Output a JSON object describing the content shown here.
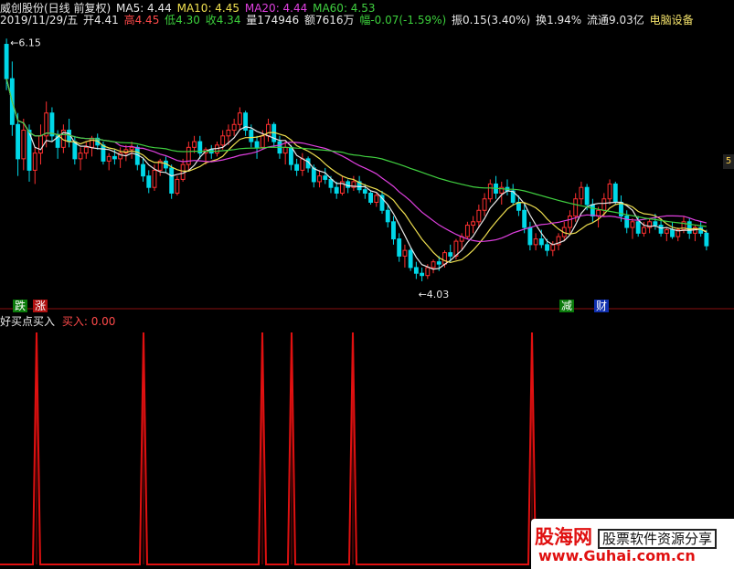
{
  "header": {
    "stock_name_date": "威创股份(日线 前复权) ",
    "ma5": "MA5: 4.44",
    "ma10": "MA10: 4.45",
    "ma20": "MA20: 4.44",
    "ma60": "MA60: 4.53",
    "date": "2019/11/29/五",
    "open": "开4.41",
    "high": "高4.45",
    "low": "低4.30",
    "close": "收4.34",
    "volume": "量174946",
    "amount": "额7616万",
    "change": "幅-0.07(-1.59%)",
    "amplitude": "振0.15(3.40%)",
    "turnover": "换1.94%",
    "float_cap": "流通9.03亿",
    "sector": "电脑设备"
  },
  "price_panel": {
    "max_label": "6.15",
    "min_label": "4.03",
    "right_tag": "5",
    "badges": [
      "跌",
      "涨",
      "减",
      "财"
    ]
  },
  "indicator_panel": {
    "name": "好买点买入",
    "value_label": "买入: 0.00"
  },
  "watermark": {
    "logo": "股海网",
    "slogan": "股票软件资源分享",
    "url": "www.Guhai.com.cn"
  },
  "colors": {
    "up": "#ff3030",
    "down": "#00d8e8",
    "ma5": "#e8e8e8",
    "ma10": "#f0e050",
    "ma20": "#e040e0",
    "ma60": "#40d040",
    "signal": "#e01010"
  },
  "chart_data": [
    {
      "type": "candlestick",
      "title": "威创股份(日线 前复权)",
      "ylim": [
        3.95,
        6.2
      ],
      "candles": [
        [
          6.1,
          6.15,
          5.7,
          5.8
        ],
        [
          5.8,
          5.95,
          5.3,
          5.4
        ],
        [
          5.4,
          5.5,
          4.95,
          5.1
        ],
        [
          5.1,
          5.45,
          5.0,
          5.35
        ],
        [
          5.35,
          5.4,
          4.9,
          5.0
        ],
        [
          5.0,
          5.2,
          4.88,
          5.15
        ],
        [
          5.15,
          5.4,
          5.05,
          5.3
        ],
        [
          5.3,
          5.6,
          5.2,
          5.5
        ],
        [
          5.5,
          5.55,
          5.25,
          5.3
        ],
        [
          5.3,
          5.35,
          5.1,
          5.2
        ],
        [
          5.2,
          5.4,
          5.15,
          5.35
        ],
        [
          5.35,
          5.45,
          5.2,
          5.25
        ],
        [
          5.25,
          5.3,
          5.05,
          5.1
        ],
        [
          5.1,
          5.2,
          5.0,
          5.15
        ],
        [
          5.15,
          5.25,
          5.1,
          5.2
        ],
        [
          5.2,
          5.3,
          5.12,
          5.28
        ],
        [
          5.28,
          5.32,
          5.18,
          5.22
        ],
        [
          5.22,
          5.25,
          5.05,
          5.08
        ],
        [
          5.08,
          5.15,
          5.0,
          5.12
        ],
        [
          5.12,
          5.18,
          5.05,
          5.1
        ],
        [
          5.1,
          5.2,
          5.02,
          5.15
        ],
        [
          5.15,
          5.22,
          5.08,
          5.18
        ],
        [
          5.18,
          5.25,
          5.1,
          5.2
        ],
        [
          5.2,
          5.22,
          5.0,
          5.05
        ],
        [
          5.05,
          5.1,
          4.9,
          4.95
        ],
        [
          4.95,
          5.0,
          4.8,
          4.85
        ],
        [
          4.85,
          5.05,
          4.82,
          5.0
        ],
        [
          5.0,
          5.1,
          4.95,
          5.08
        ],
        [
          5.08,
          5.12,
          4.98,
          5.02
        ],
        [
          5.02,
          5.05,
          4.75,
          4.8
        ],
        [
          4.8,
          4.95,
          4.78,
          4.92
        ],
        [
          4.92,
          5.1,
          4.9,
          5.05
        ],
        [
          5.05,
          5.25,
          5.0,
          5.2
        ],
        [
          5.2,
          5.3,
          5.15,
          5.25
        ],
        [
          5.25,
          5.3,
          5.1,
          5.15
        ],
        [
          5.15,
          5.2,
          5.05,
          5.18
        ],
        [
          5.18,
          5.22,
          5.1,
          5.15
        ],
        [
          5.15,
          5.25,
          5.12,
          5.22
        ],
        [
          5.22,
          5.35,
          5.18,
          5.3
        ],
        [
          5.3,
          5.4,
          5.22,
          5.35
        ],
        [
          5.35,
          5.45,
          5.3,
          5.4
        ],
        [
          5.4,
          5.55,
          5.35,
          5.5
        ],
        [
          5.5,
          5.52,
          5.3,
          5.35
        ],
        [
          5.35,
          5.4,
          5.2,
          5.25
        ],
        [
          5.25,
          5.3,
          5.1,
          5.2
        ],
        [
          5.2,
          5.35,
          5.18,
          5.3
        ],
        [
          5.3,
          5.45,
          5.25,
          5.4
        ],
        [
          5.4,
          5.42,
          5.2,
          5.25
        ],
        [
          5.25,
          5.3,
          5.1,
          5.15
        ],
        [
          5.15,
          5.25,
          5.05,
          5.2
        ],
        [
          5.2,
          5.22,
          5.0,
          5.05
        ],
        [
          5.05,
          5.1,
          4.95,
          5.0
        ],
        [
          5.0,
          5.15,
          4.95,
          5.1
        ],
        [
          5.1,
          5.12,
          4.98,
          5.02
        ],
        [
          5.02,
          5.05,
          4.85,
          4.9
        ],
        [
          4.9,
          5.0,
          4.85,
          4.95
        ],
        [
          4.95,
          5.02,
          4.88,
          4.92
        ],
        [
          4.92,
          4.95,
          4.8,
          4.85
        ],
        [
          4.85,
          4.9,
          4.75,
          4.8
        ],
        [
          4.8,
          4.95,
          4.78,
          4.9
        ],
        [
          4.9,
          4.92,
          4.8,
          4.85
        ],
        [
          4.85,
          4.95,
          4.82,
          4.9
        ],
        [
          4.9,
          4.95,
          4.8,
          4.83
        ],
        [
          4.83,
          4.88,
          4.75,
          4.8
        ],
        [
          4.8,
          4.82,
          4.7,
          4.72
        ],
        [
          4.72,
          4.8,
          4.68,
          4.78
        ],
        [
          4.78,
          4.82,
          4.62,
          4.65
        ],
        [
          4.65,
          4.7,
          4.5,
          4.55
        ],
        [
          4.55,
          4.6,
          4.35,
          4.4
        ],
        [
          4.4,
          4.45,
          4.2,
          4.25
        ],
        [
          4.25,
          4.35,
          4.15,
          4.3
        ],
        [
          4.3,
          4.32,
          4.12,
          4.15
        ],
        [
          4.15,
          4.2,
          4.05,
          4.1
        ],
        [
          4.1,
          4.15,
          4.03,
          4.08
        ],
        [
          4.08,
          4.18,
          4.05,
          4.15
        ],
        [
          4.15,
          4.22,
          4.1,
          4.2
        ],
        [
          4.2,
          4.25,
          4.12,
          4.18
        ],
        [
          4.18,
          4.3,
          4.15,
          4.28
        ],
        [
          4.28,
          4.35,
          4.2,
          4.25
        ],
        [
          4.25,
          4.4,
          4.22,
          4.38
        ],
        [
          4.38,
          4.45,
          4.3,
          4.42
        ],
        [
          4.42,
          4.55,
          4.4,
          4.52
        ],
        [
          4.52,
          4.6,
          4.45,
          4.55
        ],
        [
          4.55,
          4.7,
          4.5,
          4.65
        ],
        [
          4.65,
          4.8,
          4.6,
          4.75
        ],
        [
          4.75,
          4.92,
          4.72,
          4.88
        ],
        [
          4.88,
          4.95,
          4.75,
          4.8
        ],
        [
          4.8,
          4.9,
          4.7,
          4.85
        ],
        [
          4.85,
          4.92,
          4.78,
          4.82
        ],
        [
          4.82,
          4.88,
          4.7,
          4.72
        ],
        [
          4.72,
          4.78,
          4.6,
          4.65
        ],
        [
          4.65,
          4.7,
          4.45,
          4.5
        ],
        [
          4.5,
          4.55,
          4.3,
          4.35
        ],
        [
          4.35,
          4.45,
          4.3,
          4.4
        ],
        [
          4.4,
          4.48,
          4.32,
          4.35
        ],
        [
          4.35,
          4.4,
          4.25,
          4.3
        ],
        [
          4.3,
          4.38,
          4.25,
          4.35
        ],
        [
          4.35,
          4.45,
          4.3,
          4.42
        ],
        [
          4.42,
          4.55,
          4.38,
          4.5
        ],
        [
          4.5,
          4.65,
          4.45,
          4.6
        ],
        [
          4.6,
          4.8,
          4.55,
          4.75
        ],
        [
          4.75,
          4.9,
          4.7,
          4.85
        ],
        [
          4.85,
          4.88,
          4.65,
          4.7
        ],
        [
          4.7,
          4.75,
          4.55,
          4.6
        ],
        [
          4.6,
          4.68,
          4.5,
          4.65
        ],
        [
          4.65,
          4.8,
          4.6,
          4.75
        ],
        [
          4.75,
          4.92,
          4.7,
          4.88
        ],
        [
          4.88,
          4.9,
          4.7,
          4.72
        ],
        [
          4.72,
          4.78,
          4.55,
          4.6
        ],
        [
          4.6,
          4.65,
          4.45,
          4.5
        ],
        [
          4.5,
          4.58,
          4.4,
          4.55
        ],
        [
          4.55,
          4.6,
          4.42,
          4.45
        ],
        [
          4.45,
          4.55,
          4.42,
          4.5
        ],
        [
          4.5,
          4.58,
          4.45,
          4.55
        ],
        [
          4.55,
          4.62,
          4.48,
          4.52
        ],
        [
          4.52,
          4.58,
          4.42,
          4.45
        ],
        [
          4.45,
          4.5,
          4.38,
          4.48
        ],
        [
          4.48,
          4.55,
          4.4,
          4.42
        ],
        [
          4.42,
          4.5,
          4.38,
          4.48
        ],
        [
          4.48,
          4.6,
          4.45,
          4.55
        ],
        [
          4.55,
          4.58,
          4.4,
          4.45
        ],
        [
          4.45,
          4.52,
          4.38,
          4.5
        ],
        [
          4.5,
          4.55,
          4.42,
          4.45
        ],
        [
          4.45,
          4.48,
          4.3,
          4.34
        ]
      ],
      "annotations": {
        "max": "6.15",
        "min": "4.03"
      }
    },
    {
      "type": "line",
      "title": "好买点买入",
      "series": [
        {
          "name": "买入",
          "values": [
            0,
            0,
            0,
            0,
            0,
            0
          ]
        }
      ],
      "signal_positions": [
        40,
        157,
        287,
        319,
        386,
        582
      ],
      "current_value": 0.0
    }
  ]
}
